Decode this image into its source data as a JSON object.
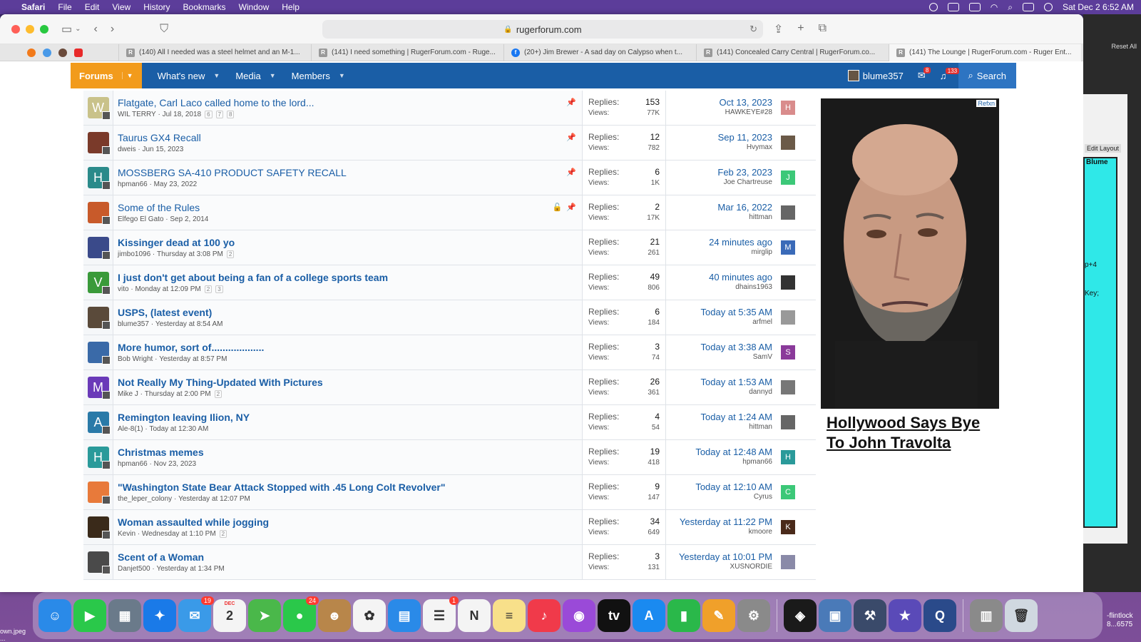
{
  "menubar": {
    "app": "Safari",
    "items": [
      "File",
      "Edit",
      "View",
      "History",
      "Bookmarks",
      "Window",
      "Help"
    ],
    "clock": "Sat Dec 2  6:52 AM"
  },
  "browser": {
    "url": "rugerforum.com",
    "tabs": [
      {
        "label": "(140) All I needed was a steel helmet and an M-1...",
        "icon": "R"
      },
      {
        "label": "(141) I need something | RugerForum.com - Ruge...",
        "icon": "R"
      },
      {
        "label": "(20+) Jim Brewer - A sad day on Calypso when t...",
        "icon": "f"
      },
      {
        "label": "(141) Concealed Carry Central | RugerForum.co...",
        "icon": "R"
      },
      {
        "label": "(141) The Lounge | RugerForum.com - Ruger Ent...",
        "icon": "R"
      }
    ]
  },
  "nav": {
    "forums": "Forums",
    "whats_new": "What's new",
    "media": "Media",
    "members": "Members",
    "username": "blume357",
    "msg_badge": "8",
    "alert_badge": "133",
    "search": "Search"
  },
  "threads": [
    {
      "title": "Flatgate, Carl Laco called home to the lord...",
      "author": "WIL TERRY",
      "date": "Jul 18, 2018",
      "pages": [
        "6",
        "7",
        "8"
      ],
      "replies": "153",
      "views": "77K",
      "last_date": "Oct 13, 2023",
      "last_user": "HAWKEYE#28",
      "last_initial": "H",
      "last_color": "#d98c8c",
      "avatar_initial": "W",
      "avatar_color": "#c9c28a",
      "unread": false,
      "pinned": true,
      "locked": false
    },
    {
      "title": "Taurus GX4 Recall",
      "author": "dweis",
      "date": "Jun 15, 2023",
      "pages": [],
      "replies": "12",
      "views": "782",
      "last_date": "Sep 11, 2023",
      "last_user": "Hvymax",
      "last_initial": "",
      "last_color": "#6b5a48",
      "avatar_initial": "",
      "avatar_color": "#7a3a2a",
      "unread": false,
      "pinned": true,
      "locked": false
    },
    {
      "title": "MOSSBERG SA-410 PRODUCT SAFETY RECALL",
      "author": "hpman66",
      "date": "May 23, 2022",
      "pages": [],
      "replies": "6",
      "views": "1K",
      "last_date": "Feb 23, 2023",
      "last_user": "Joe Chartreuse",
      "last_initial": "J",
      "last_color": "#3cc878",
      "avatar_initial": "H",
      "avatar_color": "#2a8a8a",
      "unread": false,
      "pinned": true,
      "locked": false
    },
    {
      "title": "Some of the Rules",
      "author": "Elfego El Gato",
      "date": "Sep 2, 2014",
      "pages": [],
      "replies": "2",
      "views": "17K",
      "last_date": "Mar 16, 2022",
      "last_user": "hittman",
      "last_initial": "",
      "last_color": "#666",
      "avatar_initial": "",
      "avatar_color": "#c85a2a",
      "unread": false,
      "pinned": true,
      "locked": true
    },
    {
      "title": "Kissinger dead at 100 yo",
      "author": "jimbo1096",
      "date": "Thursday at 3:08 PM",
      "pages": [
        "2"
      ],
      "replies": "21",
      "views": "261",
      "last_date": "24 minutes ago",
      "last_user": "mirglip",
      "last_initial": "M",
      "last_color": "#3a6ab8",
      "avatar_initial": "",
      "avatar_color": "#3a4a8a",
      "unread": true,
      "pinned": false,
      "locked": false
    },
    {
      "title": "I just don't get about being a fan of a college sports team",
      "author": "vito",
      "date": "Monday at 12:09 PM",
      "pages": [
        "2",
        "3"
      ],
      "replies": "49",
      "views": "806",
      "last_date": "40 minutes ago",
      "last_user": "dhains1963",
      "last_initial": "",
      "last_color": "#333",
      "avatar_initial": "V",
      "avatar_color": "#3a9a3a",
      "unread": true,
      "pinned": false,
      "locked": false
    },
    {
      "title": "USPS, (latest event)",
      "author": "blume357",
      "date": "Yesterday at 8:54 AM",
      "pages": [],
      "replies": "6",
      "views": "184",
      "last_date": "Today at 5:35 AM",
      "last_user": "arfmel",
      "last_initial": "",
      "last_color": "#999",
      "avatar_initial": "",
      "avatar_color": "#5a4a3a",
      "unread": true,
      "pinned": false,
      "locked": false
    },
    {
      "title": "More humor, sort of...................",
      "author": "Bob Wright",
      "date": "Yesterday at 8:57 PM",
      "pages": [],
      "replies": "3",
      "views": "74",
      "last_date": "Today at 3:38 AM",
      "last_user": "SamV",
      "last_initial": "S",
      "last_color": "#8a3a9a",
      "avatar_initial": "",
      "avatar_color": "#3a6aa8",
      "unread": true,
      "pinned": false,
      "locked": false
    },
    {
      "title": "Not Really My Thing-Updated With Pictures",
      "author": "Mike J",
      "date": "Thursday at 2:00 PM",
      "pages": [
        "2"
      ],
      "replies": "26",
      "views": "361",
      "last_date": "Today at 1:53 AM",
      "last_user": "dannyd",
      "last_initial": "",
      "last_color": "#777",
      "avatar_initial": "M",
      "avatar_color": "#6a3ab8",
      "unread": true,
      "pinned": false,
      "locked": false
    },
    {
      "title": "Remington leaving Ilion, NY",
      "author": "Ale-8(1)",
      "date": "Today at 12:30 AM",
      "pages": [],
      "replies": "4",
      "views": "54",
      "last_date": "Today at 1:24 AM",
      "last_user": "hittman",
      "last_initial": "",
      "last_color": "#666",
      "avatar_initial": "A",
      "avatar_color": "#2a7aa8",
      "unread": true,
      "pinned": false,
      "locked": false
    },
    {
      "title": "Christmas memes",
      "author": "hpman66",
      "date": "Nov 23, 2023",
      "pages": [],
      "replies": "19",
      "views": "418",
      "last_date": "Today at 12:48 AM",
      "last_user": "hpman66",
      "last_initial": "H",
      "last_color": "#2a9a9a",
      "avatar_initial": "H",
      "avatar_color": "#2a9a9a",
      "unread": true,
      "pinned": false,
      "locked": false
    },
    {
      "title": "\"Washington State Bear Attack Stopped with .45 Long Colt Revolver\"",
      "author": "the_leper_colony",
      "date": "Yesterday at 12:07 PM",
      "pages": [],
      "replies": "9",
      "views": "147",
      "last_date": "Today at 12:10 AM",
      "last_user": "Cyrus",
      "last_initial": "C",
      "last_color": "#3cc878",
      "avatar_initial": "",
      "avatar_color": "#e87a3a",
      "unread": true,
      "pinned": false,
      "locked": false
    },
    {
      "title": "Woman assaulted while jogging",
      "author": "Kevin",
      "date": "Wednesday at 1:10 PM",
      "pages": [
        "2"
      ],
      "replies": "34",
      "views": "649",
      "last_date": "Yesterday at 11:22 PM",
      "last_user": "kmoore",
      "last_initial": "K",
      "last_color": "#4a2a1a",
      "avatar_initial": "",
      "avatar_color": "#3a2a1a",
      "unread": true,
      "pinned": false,
      "locked": false
    },
    {
      "title": "Scent of a Woman",
      "author": "Danjet500",
      "date": "Yesterday at 1:34 PM",
      "pages": [],
      "replies": "3",
      "views": "131",
      "last_date": "Yesterday at 10:01 PM",
      "last_user": "XUSNORDIE",
      "last_initial": "",
      "last_color": "#8a8aa8",
      "avatar_initial": "",
      "avatar_color": "#4a4a4a",
      "unread": true,
      "pinned": false,
      "locked": false
    }
  ],
  "labels": {
    "replies": "Replies:",
    "views": "Views:"
  },
  "ad": {
    "headline": "Hollywood Says Bye To John Travolta",
    "badge": "Refxn"
  },
  "sidepanel": {
    "reset": "Reset All",
    "edit_layout": "Edit Layout",
    "blume": "Blume",
    "key": "Key;",
    "p4": "p+4"
  },
  "dock": {
    "apps": [
      {
        "name": "finder",
        "color": "#2a8ae8",
        "glyph": "☺"
      },
      {
        "name": "facetime",
        "color": "#2ac84a",
        "glyph": "▶"
      },
      {
        "name": "launchpad",
        "color": "#6a7a8a",
        "glyph": "▦"
      },
      {
        "name": "safari",
        "color": "#1a7ae8",
        "glyph": "✦"
      },
      {
        "name": "mail",
        "color": "#3a9ae8",
        "glyph": "✉",
        "badge": "19"
      },
      {
        "name": "calendar",
        "color": "#f4f4f4",
        "glyph": "2",
        "label": "DEC"
      },
      {
        "name": "maps",
        "color": "#4ab84a",
        "glyph": "➤"
      },
      {
        "name": "messages",
        "color": "#2ac84a",
        "glyph": "●",
        "badge": "24"
      },
      {
        "name": "contacts",
        "color": "#b8864a",
        "glyph": "☻"
      },
      {
        "name": "photos",
        "color": "#f4f4f4",
        "glyph": "✿"
      },
      {
        "name": "keynote",
        "color": "#2a8ae8",
        "glyph": "▤"
      },
      {
        "name": "reminders",
        "color": "#f4f4f4",
        "glyph": "☰",
        "badge": "1"
      },
      {
        "name": "news",
        "color": "#f4f4f4",
        "glyph": "N"
      },
      {
        "name": "notes",
        "color": "#f8e08a",
        "glyph": "≡"
      },
      {
        "name": "music",
        "color": "#f03a4a",
        "glyph": "♪"
      },
      {
        "name": "podcasts",
        "color": "#9a4ad8",
        "glyph": "◉"
      },
      {
        "name": "appletv",
        "color": "#111",
        "glyph": "tv"
      },
      {
        "name": "appstore",
        "color": "#1a8af0",
        "glyph": "A"
      },
      {
        "name": "numbers",
        "color": "#2ab84a",
        "glyph": "▮"
      },
      {
        "name": "pages",
        "color": "#f0a02a",
        "glyph": "✎"
      },
      {
        "name": "settings",
        "color": "#8a8a8a",
        "glyph": "⚙"
      },
      {
        "name": "sep",
        "color": "",
        "glyph": ""
      },
      {
        "name": "app-a",
        "color": "#1a1a1a",
        "glyph": "◈"
      },
      {
        "name": "preview",
        "color": "#4a7ab8",
        "glyph": "▣"
      },
      {
        "name": "xcode",
        "color": "#3a4a6a",
        "glyph": "⚒"
      },
      {
        "name": "imovie",
        "color": "#5a4ab8",
        "glyph": "★"
      },
      {
        "name": "quicktime",
        "color": "#2a4a8a",
        "glyph": "Q"
      },
      {
        "name": "sep",
        "color": "",
        "glyph": ""
      },
      {
        "name": "downloads",
        "color": "#8a8a8a",
        "glyph": "▥"
      },
      {
        "name": "trash",
        "color": "#d0d8e0",
        "glyph": "🗑"
      }
    ]
  },
  "desktop": {
    "bottom_left": "own.jpeg ...",
    "bottom_right": "-flintlock 8...6575"
  }
}
